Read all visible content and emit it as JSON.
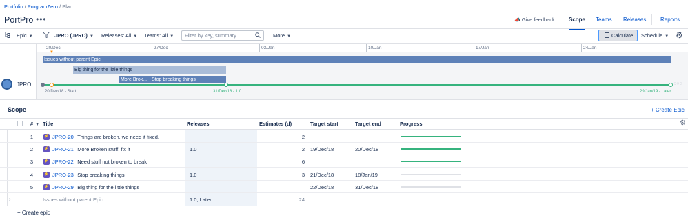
{
  "breadcrumb": {
    "portfolio": "Portfolio",
    "program": "ProgramZero",
    "current": "Plan",
    "sep": "/"
  },
  "title": "PortPro",
  "more_dots": "•••",
  "feedback": "Give feedback",
  "tabs": [
    "Scope",
    "Teams",
    "Releases",
    "Reports"
  ],
  "toolbar": {
    "hierarchy": "Epic",
    "project": "JPRO (JPRO)",
    "releases": "Releases: All",
    "teams": "Teams: All",
    "filter_placeholder": "Filter by key, summary",
    "more": "More",
    "calculate": "Calculate",
    "schedule": "Schedule"
  },
  "timeline": {
    "dates": [
      "20/Dec",
      "27/Dec",
      "03/Jan",
      "10/Jan",
      "17/Jan",
      "24/Jan"
    ],
    "bars": [
      {
        "label": "Issues without parent Epic"
      },
      {
        "label": "Big thing for the little things"
      },
      {
        "label": "More Brok..."
      },
      {
        "label": "Stop breaking things"
      }
    ],
    "avatar_label": "JPRO",
    "footer": {
      "start": "20/Dec/18 - Start",
      "release": "31/Dec/18 - 1.0",
      "later": "29/Jan/19 - Later"
    }
  },
  "scope": {
    "title": "Scope",
    "create_epic_top": "+ Create Epic",
    "headers": {
      "num": "#",
      "title": "Title",
      "releases": "Releases",
      "estimates": "Estimates (d)",
      "target_start": "Target start",
      "target_end": "Target end",
      "progress": "Progress"
    },
    "rows": [
      {
        "num": "1",
        "key": "JPRO-20",
        "summary": "Things are broken, we need it fixed.",
        "release": "",
        "estimate": "2",
        "start": "",
        "end": "",
        "progress": 1.0
      },
      {
        "num": "2",
        "key": "JPRO-21",
        "summary": "More Broken stuff, fix it",
        "release": "1.0",
        "estimate": "2",
        "start": "19/Dec/18",
        "end": "20/Dec/18",
        "progress": 1.0
      },
      {
        "num": "3",
        "key": "JPRO-22",
        "summary": "Need stuff not broken to break",
        "release": "",
        "estimate": "6",
        "start": "",
        "end": "",
        "progress": 1.0
      },
      {
        "num": "4",
        "key": "JPRO-23",
        "summary": "Stop breaking things",
        "release": "1.0",
        "estimate": "3",
        "start": "21/Dec/18",
        "end": "18/Jan/19",
        "progress": 0.0
      },
      {
        "num": "5",
        "key": "JPRO-29",
        "summary": "Big thing for the little things",
        "release": "",
        "estimate": "",
        "start": "22/Dec/18",
        "end": "31/Dec/18",
        "progress": 0.0
      }
    ],
    "orphan": {
      "label": "Issues without parent Epic",
      "release": "1.0, Later",
      "estimate": "24"
    },
    "create_epic_bottom": "+ Create epic"
  }
}
